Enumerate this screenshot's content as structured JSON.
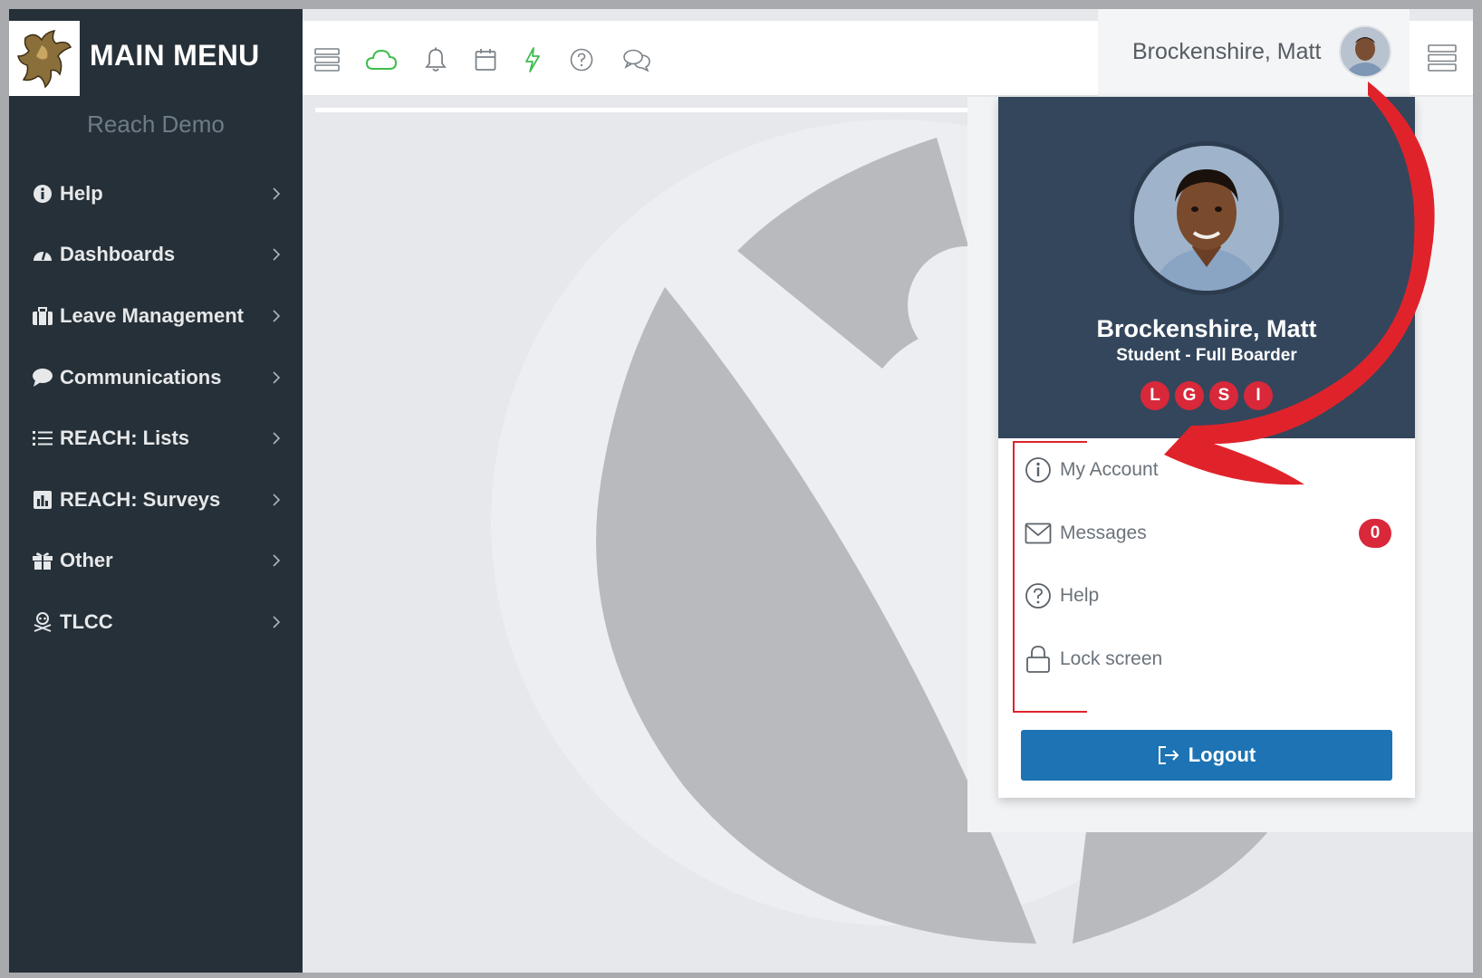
{
  "sidebar": {
    "title": "MAIN MENU",
    "org_name": "Reach Demo",
    "items": [
      {
        "label": "Help",
        "icon": "info-circle-icon"
      },
      {
        "label": "Dashboards",
        "icon": "dashboard-gauge-icon"
      },
      {
        "label": "Leave Management",
        "icon": "briefcase-icon"
      },
      {
        "label": "Communications",
        "icon": "speech-bubble-icon"
      },
      {
        "label": "REACH: Lists",
        "icon": "list-icon"
      },
      {
        "label": "REACH: Surveys",
        "icon": "bar-chart-icon"
      },
      {
        "label": "Other",
        "icon": "gift-icon"
      },
      {
        "label": "TLCC",
        "icon": "skull-crossbones-icon"
      }
    ]
  },
  "topbar": {
    "icons": [
      "stack-menu-icon",
      "cloud-icon",
      "bell-icon",
      "calendar-icon",
      "lightning-icon",
      "question-circle-icon",
      "chat-bubbles-icon"
    ],
    "user_name": "Brockenshire, Matt"
  },
  "dropdown": {
    "name": "Brockenshire, Matt",
    "role": "Student - Full Boarder",
    "badges": [
      "L",
      "G",
      "S",
      "I"
    ],
    "items": [
      {
        "label": "My Account",
        "icon": "info-circle-icon"
      },
      {
        "label": "Messages",
        "icon": "envelope-icon",
        "count": "0"
      },
      {
        "label": "Help",
        "icon": "question-circle-icon"
      },
      {
        "label": "Lock screen",
        "icon": "lock-icon"
      }
    ],
    "logout_label": "Logout"
  },
  "colors": {
    "sidebar_bg": "#263038",
    "profile_header_bg": "#33465c",
    "badge_red": "#d8283a",
    "logout_blue": "#1d73b3",
    "accent_green": "#3cbd4d",
    "annotation_red": "#e0232b"
  }
}
